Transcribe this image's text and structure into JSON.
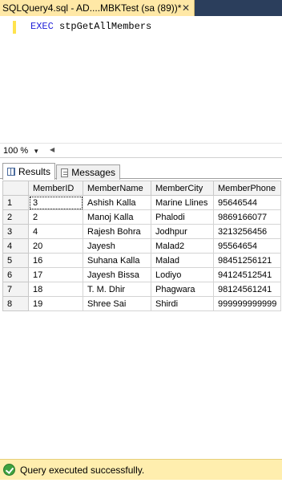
{
  "document_tab": {
    "title": "SQLQuery4.sql - AD....MBKTest (sa (89))*",
    "close_glyph": "✕"
  },
  "editor": {
    "keyword": "EXEC",
    "procedure": "stpGetAllMembers"
  },
  "zoom": {
    "value": "100 %",
    "dropdown_glyph": "▼",
    "scroll_left_glyph": "◀"
  },
  "results_tabs": [
    {
      "label": "Results",
      "icon": "grid-icon",
      "active": true
    },
    {
      "label": "Messages",
      "icon": "messages-icon",
      "active": false
    }
  ],
  "grid": {
    "columns": [
      "MemberID",
      "MemberName",
      "MemberCity",
      "MemberPhone"
    ],
    "rows": [
      {
        "n": "1",
        "id": "3",
        "name": "Ashish Kalla",
        "city": "Marine Llines",
        "phone": "95646544"
      },
      {
        "n": "2",
        "id": "2",
        "name": "Manoj Kalla",
        "city": "Phalodi",
        "phone": "9869166077"
      },
      {
        "n": "3",
        "id": "4",
        "name": "Rajesh Bohra",
        "city": "Jodhpur",
        "phone": "3213256456"
      },
      {
        "n": "4",
        "id": "20",
        "name": "Jayesh",
        "city": "Malad2",
        "phone": "95564654"
      },
      {
        "n": "5",
        "id": "16",
        "name": "Suhana Kalla",
        "city": "Malad",
        "phone": "98451256121"
      },
      {
        "n": "6",
        "id": "17",
        "name": "Jayesh Bissa",
        "city": "Lodiyo",
        "phone": "94124512541"
      },
      {
        "n": "7",
        "id": "18",
        "name": "T. M. Dhir",
        "city": "Phagwara",
        "phone": "98124561241"
      },
      {
        "n": "8",
        "id": "19",
        "name": "Shree Sai",
        "city": "Shirdi",
        "phone": "999999999999"
      }
    ]
  },
  "status": {
    "text": "Query executed successfully.",
    "icon": "success-check-icon"
  },
  "colors": {
    "tab_bar": "#2b3e5c",
    "active_doc_tab": "#ffe8a6",
    "sql_keyword": "#1f1fd8",
    "status_bar": "#ffeeae",
    "success_green": "#3fa23f"
  }
}
